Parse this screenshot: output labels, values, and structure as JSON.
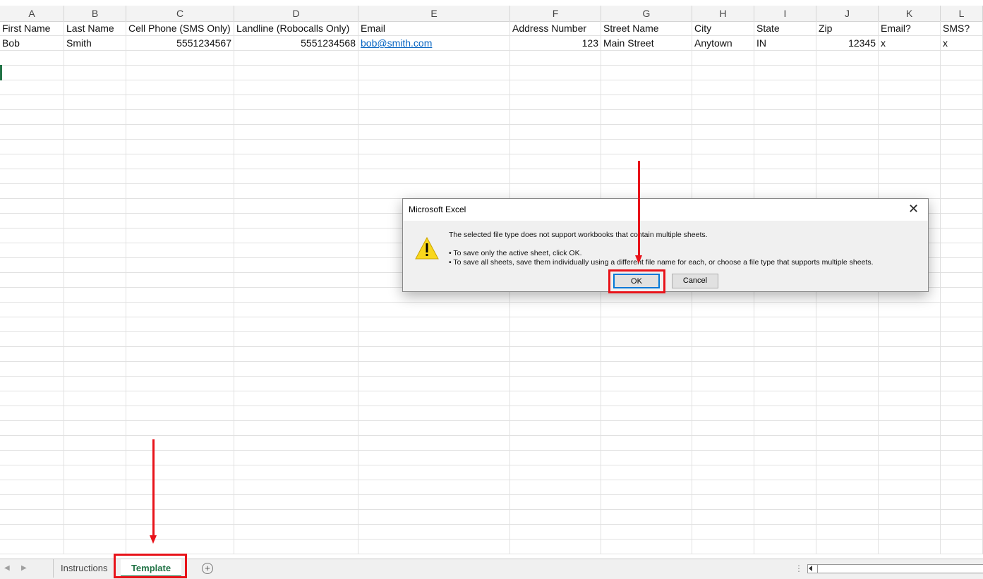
{
  "columns": [
    "A",
    "B",
    "C",
    "D",
    "E",
    "F",
    "G",
    "H",
    "I",
    "J",
    "K",
    "L"
  ],
  "rows": [
    [
      "First Name",
      "Last Name",
      "Cell Phone (SMS Only)",
      "Landline (Robocalls Only)",
      "Email",
      "Address Number",
      "Street Name",
      "City",
      "State",
      "Zip",
      "Email?",
      "SMS?"
    ],
    [
      "Bob",
      "Smith",
      "5551234567",
      "5551234568",
      "bob@smith.com",
      "123",
      "Main Street",
      "Anytown",
      "IN",
      "12345",
      "x",
      "x"
    ]
  ],
  "dialog": {
    "title": "Microsoft Excel",
    "close_symbol": "✕",
    "line1": "The selected file type does not support workbooks that contain multiple sheets.",
    "line2": "• To save only the active sheet, click OK.",
    "line3": "• To save all sheets, save them individually using a different file name for each, or choose a file type that supports multiple sheets.",
    "ok_label": "OK",
    "cancel_label": "Cancel"
  },
  "tabs": {
    "instructions": "Instructions",
    "template": "Template",
    "add_symbol": "+",
    "scroll_dots": "⋮"
  },
  "colors": {
    "excel_green": "#217346",
    "highlight_red": "#e8131a",
    "link_blue": "#0563c1"
  }
}
